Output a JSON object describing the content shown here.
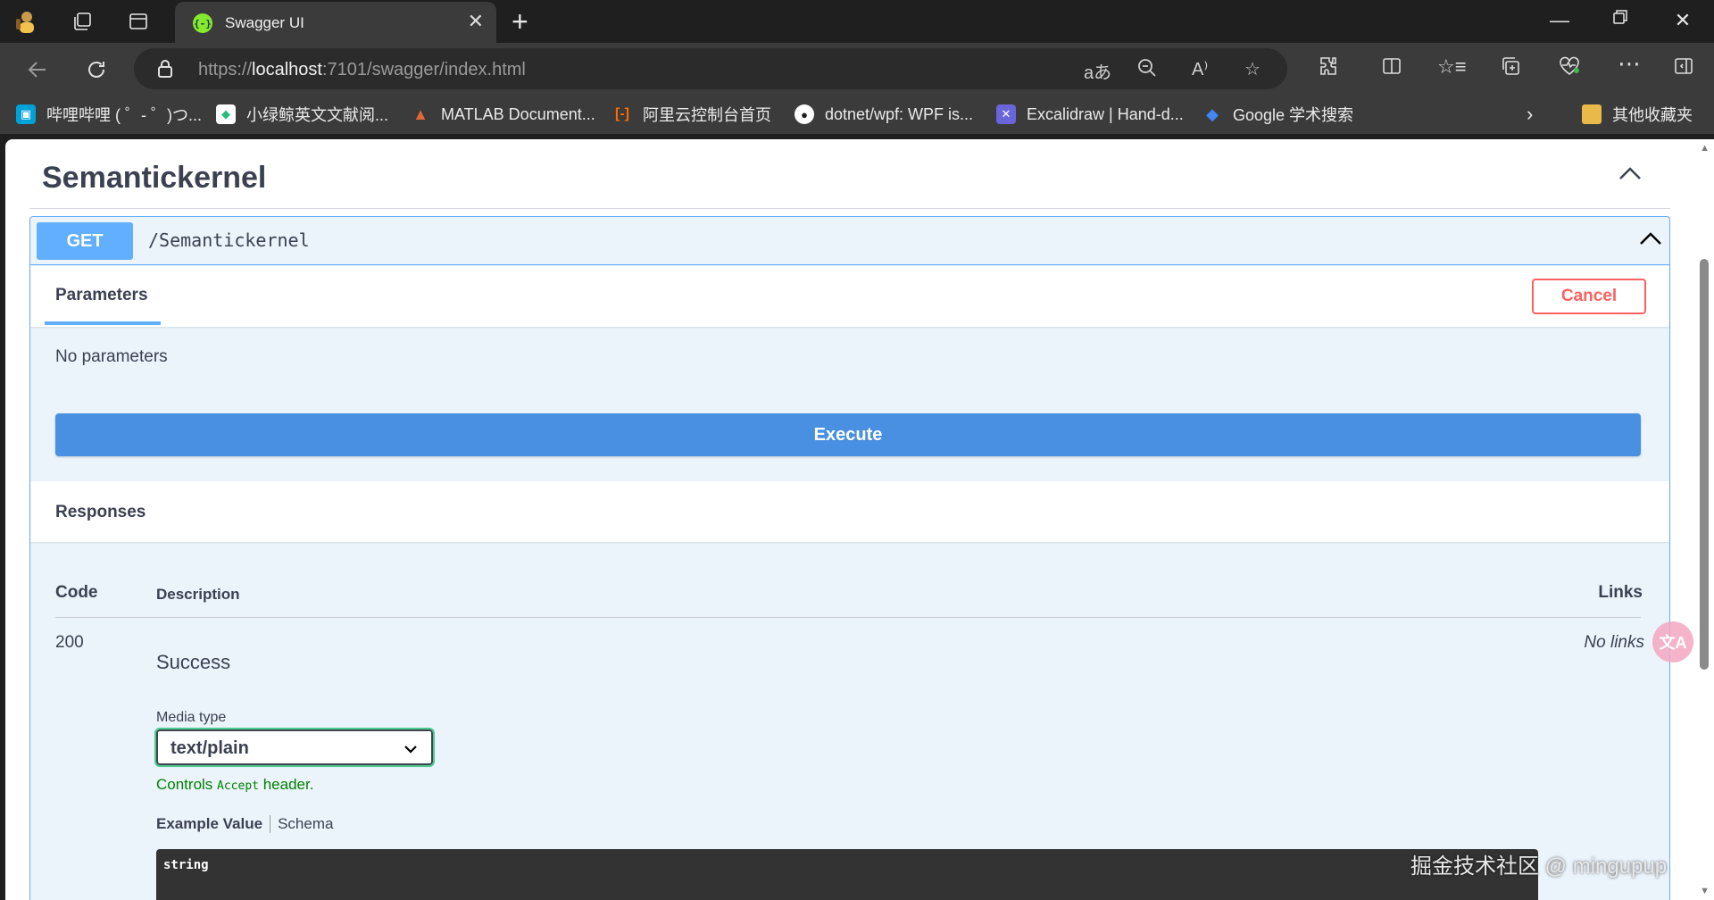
{
  "browser": {
    "tab_title": "Swagger UI",
    "url_prefix": "https://",
    "url_host": "localhost",
    "url_rest": ":7101/swagger/index.html",
    "icons": [
      "profile-avatar-icon",
      "workspaces-icon",
      "tab-actions-icon",
      "swagger-favicon",
      "close-icon",
      "plus-icon",
      "minimize-icon",
      "restore-icon",
      "back-icon",
      "refresh-icon",
      "lock-icon",
      "read-aloud-icon",
      "zoom-icon",
      "favorite-star-icon",
      "extensions-icon",
      "split-screen-icon",
      "favorites-icon",
      "collections-icon",
      "health-icon",
      "more-icon",
      "sidebar-icon"
    ]
  },
  "bookmarks": [
    {
      "label": "哔哩哔哩 ( ゜- ゜)つ...",
      "icon": "bilibili-icon",
      "color": "#00a1d6"
    },
    {
      "label": "小绿鲸英文文献阅...",
      "icon": "green-whale-icon",
      "color": "#2bbd7e"
    },
    {
      "label": "MATLAB Document...",
      "icon": "matlab-icon",
      "color": "#e16737"
    },
    {
      "label": "阿里云控制台首页",
      "icon": "aliyun-icon",
      "color": "#ff6a00"
    },
    {
      "label": "dotnet/wpf: WPF is...",
      "icon": "github-icon",
      "color": "#ffffff"
    },
    {
      "label": "Excalidraw | Hand-d...",
      "icon": "excalidraw-icon",
      "color": "#6965db"
    },
    {
      "label": "Google 学术搜索",
      "icon": "google-scholar-icon",
      "color": "#4285f4"
    }
  ],
  "bookmarks_other": "其他收藏夹",
  "swagger": {
    "section_title": "Semantickernel",
    "method": "GET",
    "path": "/Semantickernel",
    "parameters_tab": "Parameters",
    "cancel_label": "Cancel",
    "no_parameters": "No parameters",
    "execute_label": "Execute",
    "responses_title": "Responses",
    "columns": {
      "code": "Code",
      "description": "Description",
      "links": "Links"
    },
    "response": {
      "code": "200",
      "description": "Success",
      "links": "No links",
      "media_type_label": "Media type",
      "media_type_value": "text/plain",
      "controls_prefix": "Controls ",
      "controls_code": "Accept",
      "controls_suffix": " header.",
      "example_tab": "Example Value",
      "schema_tab": "Schema",
      "example_code": "string"
    },
    "colors": {
      "get": "#61affe",
      "execute": "#4990e2",
      "cancel": "#ff6060",
      "accent_green": "#49cc90"
    }
  },
  "overlay": {
    "translate_icon": "文A",
    "watermark": "掘金技术社区 @ mingupup"
  }
}
